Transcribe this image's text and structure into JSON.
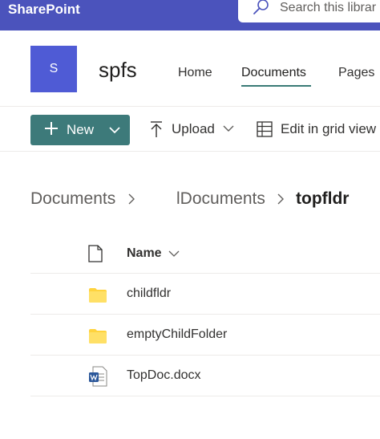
{
  "suitebar": {
    "brand": "SharePoint",
    "search_placeholder": "Search this librar"
  },
  "site": {
    "logo_letter": "S",
    "title": "spfs",
    "nav": [
      {
        "label": "Home"
      },
      {
        "label": "Documents",
        "selected": true
      },
      {
        "label": "Pages"
      }
    ]
  },
  "commandbar": {
    "new_label": "New",
    "upload_label": "Upload",
    "grid_label": "Edit in grid view"
  },
  "breadcrumb": [
    {
      "label": "Documents"
    },
    {
      "label": "lDocuments"
    },
    {
      "label": "topfldr"
    }
  ],
  "list": {
    "column_name": "Name",
    "rows": [
      {
        "name": "childfldr",
        "icon": "folder-icon"
      },
      {
        "name": "emptyChildFolder",
        "icon": "folder-icon"
      },
      {
        "name": "TopDoc.docx",
        "icon": "word-doc-icon"
      }
    ]
  },
  "colors": {
    "suitebar": "#4b53bc",
    "accent": "#3d7a7a",
    "folder": "#ffd33d"
  }
}
